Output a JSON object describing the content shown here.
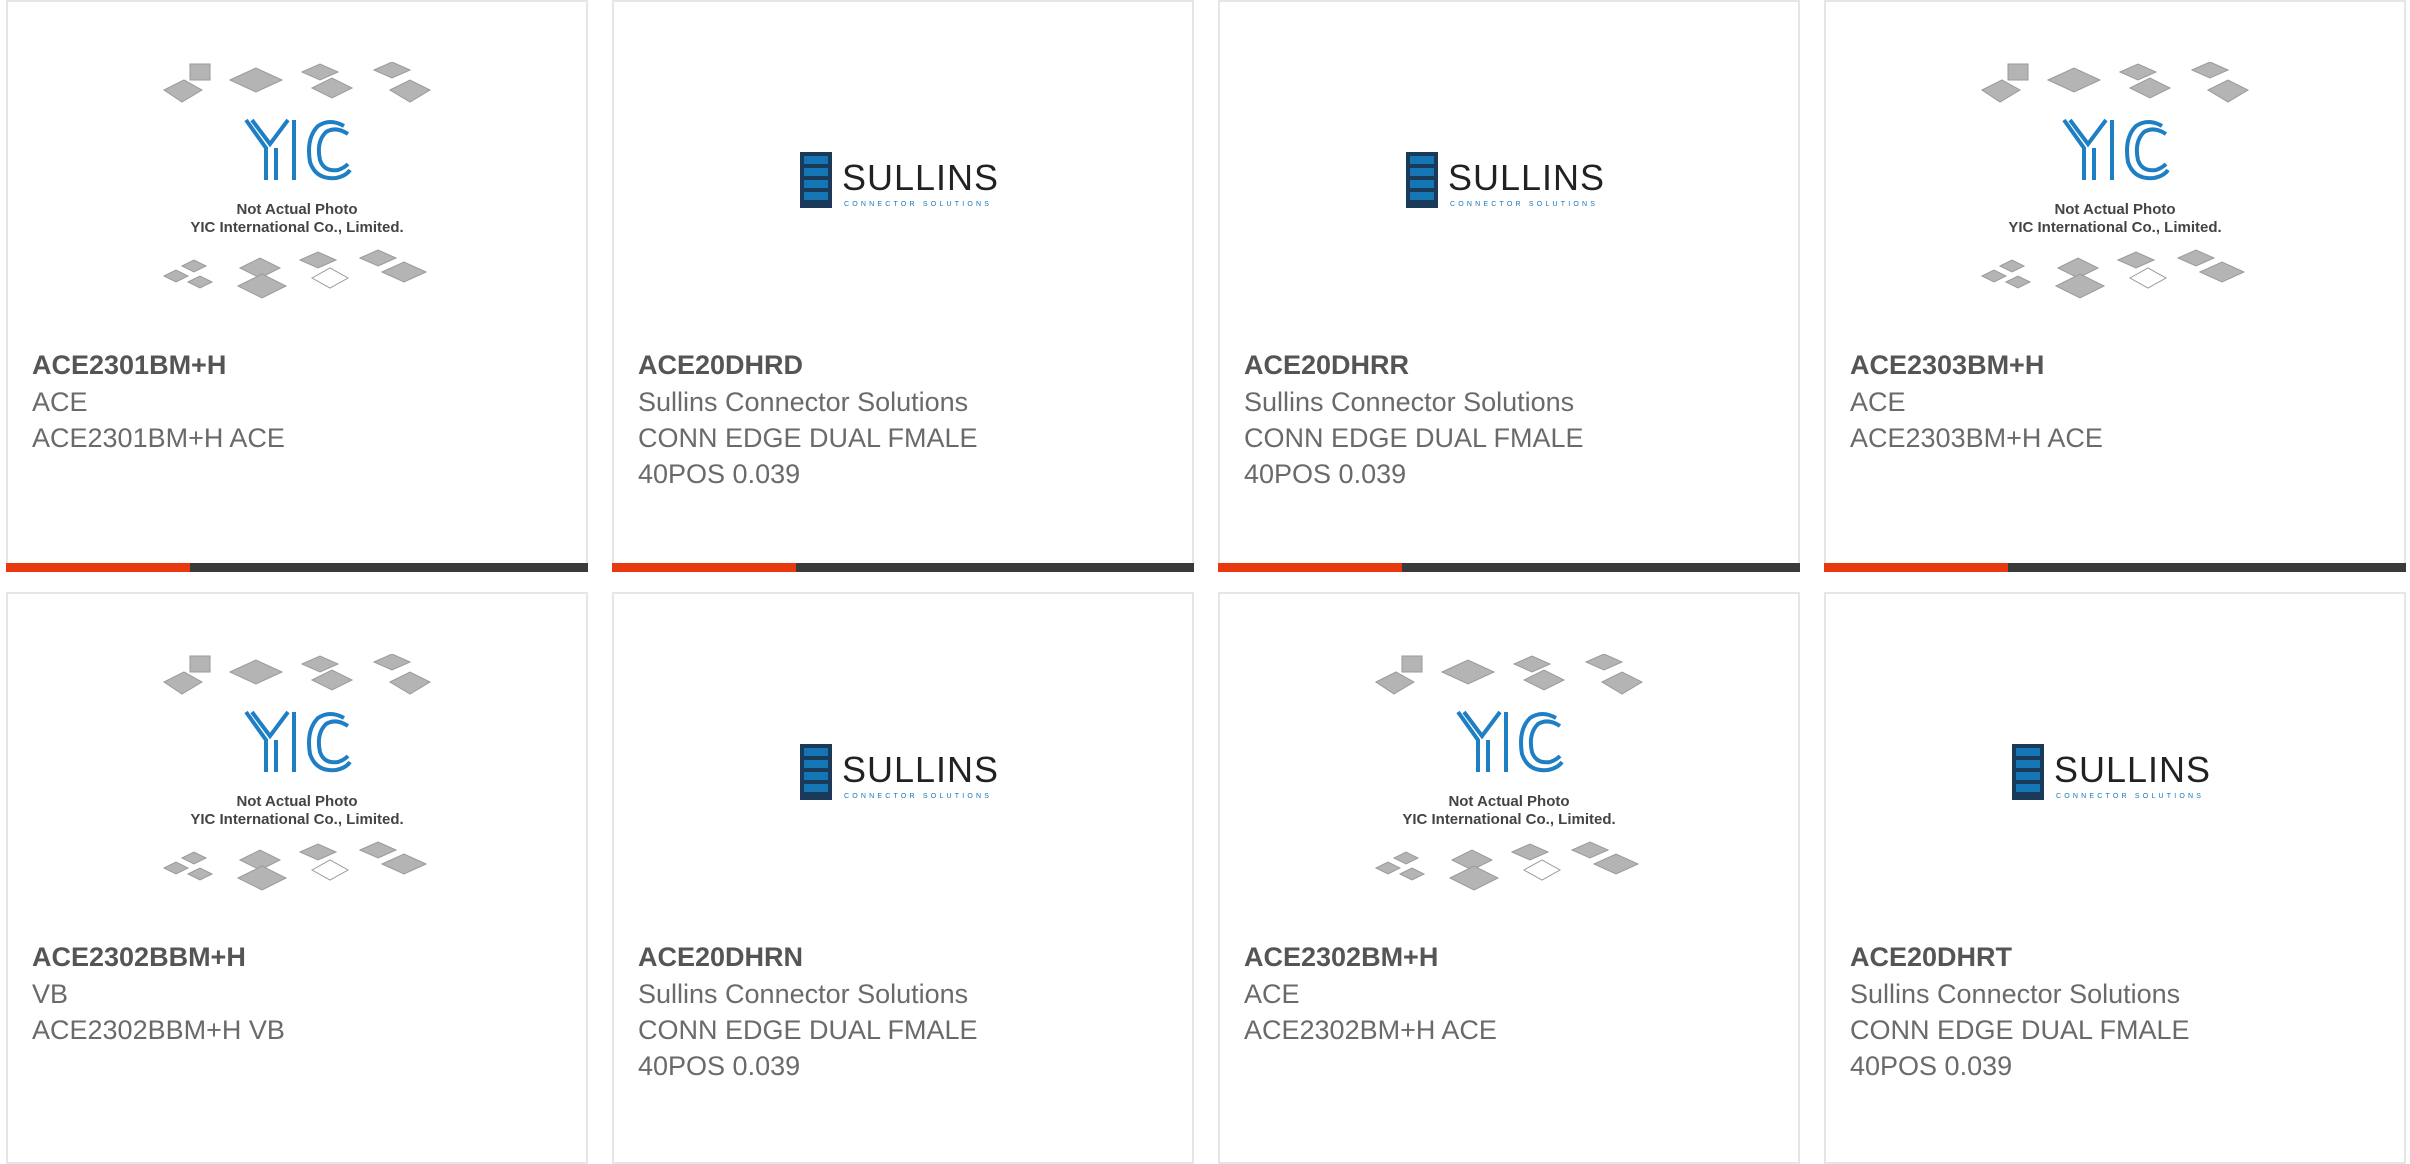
{
  "colors": {
    "accent": "#e8380d",
    "bar_dark": "#3a3a3a",
    "card_border": "#e6e6e6",
    "text_title": "#555555",
    "text_body": "#6a6a6a",
    "yic_blue": "#1f7fc4",
    "sullins_blue": "#1576b6",
    "sullins_text": "#222222"
  },
  "yic_logo": {
    "letters": "YIC",
    "caption_line1": "Not Actual Photo",
    "caption_line2": "YIC International Co., Limited."
  },
  "sullins_logo": {
    "wordmark": "SULLINS",
    "tagline": "CONNECTOR SOLUTIONS"
  },
  "products": [
    {
      "part": "ACE2301BM+H",
      "logo": "yic",
      "lines": [
        "ACE",
        "ACE2301BM+H ACE"
      ]
    },
    {
      "part": "ACE20DHRD",
      "logo": "sullins",
      "lines": [
        "Sullins Connector Solutions",
        "CONN EDGE DUAL FMALE",
        "40POS 0.039"
      ]
    },
    {
      "part": "ACE20DHRR",
      "logo": "sullins",
      "lines": [
        "Sullins Connector Solutions",
        "CONN EDGE DUAL FMALE",
        "40POS 0.039"
      ]
    },
    {
      "part": "ACE2303BM+H",
      "logo": "yic",
      "lines": [
        "ACE",
        "ACE2303BM+H ACE"
      ]
    },
    {
      "part": "ACE2302BBM+H",
      "logo": "yic",
      "lines": [
        "VB",
        "ACE2302BBM+H VB"
      ]
    },
    {
      "part": "ACE20DHRN",
      "logo": "sullins",
      "lines": [
        "Sullins Connector Solutions",
        "CONN EDGE DUAL FMALE",
        "40POS 0.039"
      ]
    },
    {
      "part": "ACE2302BM+H",
      "logo": "yic",
      "lines": [
        "ACE",
        "ACE2302BM+H ACE"
      ]
    },
    {
      "part": "ACE20DHRT",
      "logo": "sullins",
      "lines": [
        "Sullins Connector Solutions",
        "CONN EDGE DUAL FMALE",
        "40POS 0.039"
      ]
    }
  ]
}
